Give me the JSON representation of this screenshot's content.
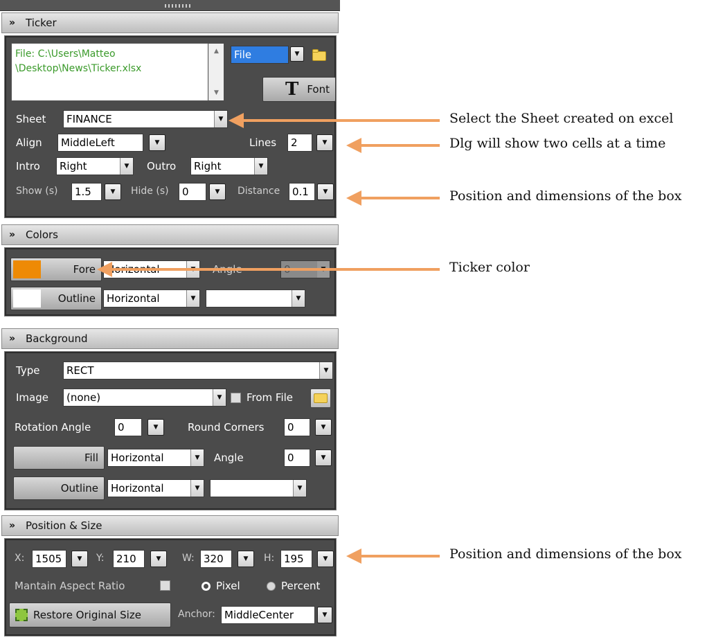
{
  "ticker": {
    "header": "Ticker",
    "file_path_line1": "File: C:\\Users\\Matteo",
    "file_path_line2": "\\Desktop\\News\\Ticker.xlsx",
    "source_value": "File",
    "font_label": "Font",
    "font_glyph": "T",
    "sheet_label": "Sheet",
    "sheet_value": "FINANCE",
    "align_label": "Align",
    "align_value": "MiddleLeft",
    "lines_label": "Lines",
    "lines_value": "2",
    "intro_label": "Intro",
    "intro_value": "Right",
    "outro_label": "Outro",
    "outro_value": "Right",
    "show_label": "Show (s)",
    "show_value": "1.5",
    "hide_label": "Hide (s)",
    "hide_value": "0",
    "distance_label": "Distance",
    "distance_value": "0.1"
  },
  "colors": {
    "header": "Colors",
    "fore_label": "Fore",
    "fore_color": "#ee8a05",
    "fore_gradient": "Horizontal",
    "angle_label": "Angle",
    "angle_value": "0",
    "outline_label": "Outline",
    "outline_color": "#ffffff",
    "outline_gradient": "Horizontal",
    "outline_extra": ""
  },
  "background": {
    "header": "Background",
    "type_label": "Type",
    "type_value": "RECT",
    "image_label": "Image",
    "image_value": "(none)",
    "from_file_label": "From File",
    "rotation_label": "Rotation Angle",
    "rotation_value": "0",
    "round_label": "Round Corners",
    "round_value": "0",
    "fill_label": "Fill",
    "fill_gradient": "Horizontal",
    "angle_label": "Angle",
    "angle_value": "0",
    "outline_label": "Outline",
    "outline_gradient": "Horizontal",
    "outline_extra": ""
  },
  "position": {
    "header": "Position & Size",
    "x_label": "X:",
    "x_value": "1505",
    "y_label": "Y:",
    "y_value": "210",
    "w_label": "W:",
    "w_value": "320",
    "h_label": "H:",
    "h_value": "195",
    "aspect_label": "Mantain Aspect Ratio",
    "pixel_label": "Pixel",
    "percent_label": "Percent",
    "restore_label": "Restore Original Size",
    "anchor_label": "Anchor:",
    "anchor_value": "MiddleCenter"
  },
  "annotations": {
    "sheet": "Select the Sheet created on excel",
    "lines": "Dlg will show two cells at a time",
    "show": "Position and dimensions of the box",
    "fore": "Ticker color",
    "position": "Position and dimensions of the box"
  },
  "colors_theme": {
    "arrow": "#f0a060",
    "panel": "#4b4b4b",
    "path_text": "#3a9a2a"
  }
}
